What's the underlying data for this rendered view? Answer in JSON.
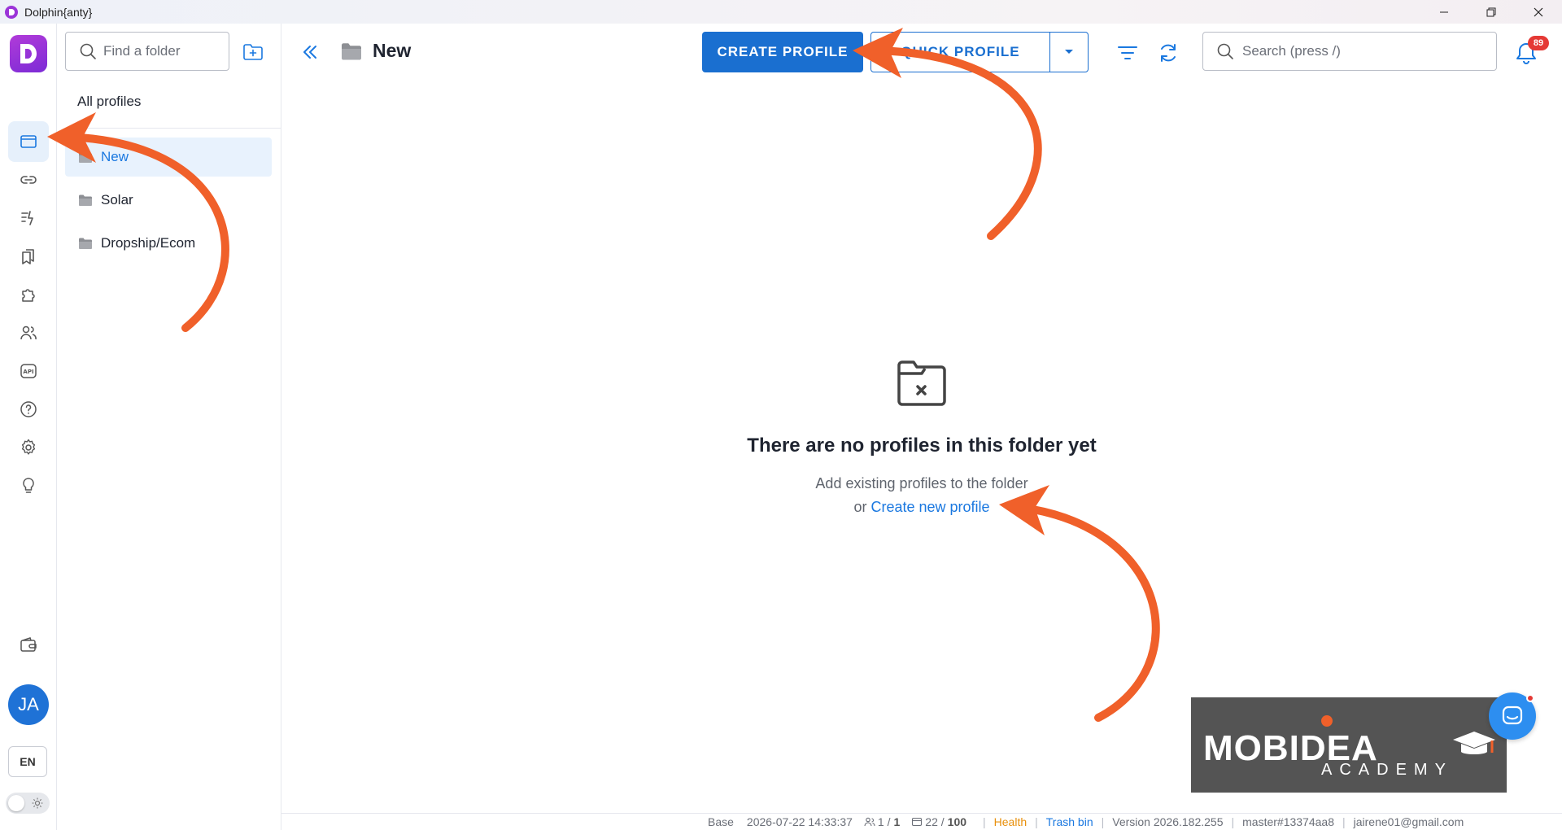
{
  "window": {
    "title": "Dolphin{anty}"
  },
  "folder_panel": {
    "search_placeholder": "Find a folder",
    "all_profiles_label": "All profiles",
    "folders": [
      {
        "name": "New",
        "active": true
      },
      {
        "name": "Solar",
        "active": false
      },
      {
        "name": "Dropship/Ecom",
        "active": false
      }
    ]
  },
  "user": {
    "initials": "JA",
    "language": "EN"
  },
  "header": {
    "folder_title": "New",
    "create_label": "CREATE PROFILE",
    "quick_label": "QUICK PROFILE",
    "search_placeholder": "Search (press /)",
    "notification_count": "89"
  },
  "empty_state": {
    "heading": "There are no profiles in this folder yet",
    "line1": "Add existing profiles to the folder",
    "line2_prefix": "or",
    "line2_link": "Create new profile"
  },
  "watermark": {
    "brand": "MOBIDEA",
    "sub": "ACADEMY"
  },
  "status_bar": {
    "base_label": "Base",
    "base_time": "2026-07-22 14:33:37",
    "users_used": "1 /",
    "users_total": "1",
    "profiles_used": "22 /",
    "profiles_total": "100",
    "health": "Health",
    "trash": "Trash bin",
    "version": "Version 2026.182.255",
    "build": "master#13374aa8",
    "email": "jairene01@gmail.com"
  },
  "colors": {
    "accent": "#1a6fd0",
    "arrow": "#f0602a",
    "logo": "#9b34d8"
  }
}
